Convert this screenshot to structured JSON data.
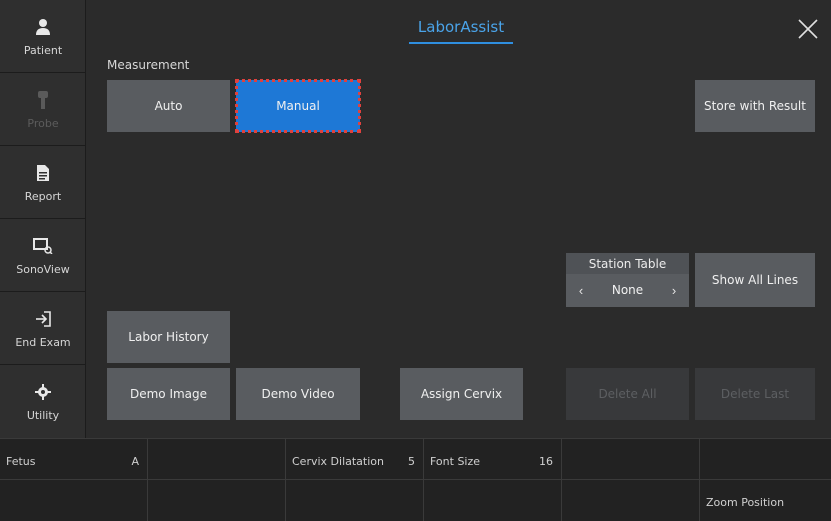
{
  "sidebar": {
    "items": [
      {
        "label": "Patient",
        "icon": "person-icon",
        "disabled": false
      },
      {
        "label": "Probe",
        "icon": "probe-icon",
        "disabled": true
      },
      {
        "label": "Report",
        "icon": "document-icon",
        "disabled": false
      },
      {
        "label": "SonoView",
        "icon": "image-search-icon",
        "disabled": false
      },
      {
        "label": "End Exam",
        "icon": "exit-icon",
        "disabled": false
      },
      {
        "label": "Utility",
        "icon": "gear-icon",
        "disabled": false
      }
    ]
  },
  "header": {
    "title": "LaborAssist"
  },
  "measurement": {
    "label": "Measurement",
    "auto_label": "Auto",
    "manual_label": "Manual",
    "selected": "Manual"
  },
  "buttons": {
    "store_with_result": "Store with Result",
    "show_all_lines": "Show All Lines",
    "labor_history": "Labor History",
    "demo_image": "Demo Image",
    "demo_video": "Demo Video",
    "assign_cervix": "Assign Cervix",
    "delete_all": "Delete All",
    "delete_last": "Delete Last"
  },
  "station_table": {
    "title": "Station Table",
    "value": "None",
    "prev": "‹",
    "next": "›"
  },
  "bottom_grid": {
    "row1": [
      {
        "key": "Fetus",
        "value": "A"
      },
      {
        "key": "",
        "value": ""
      },
      {
        "key": "Cervix Dilatation",
        "value": "5"
      },
      {
        "key": "Font Size",
        "value": "16"
      },
      {
        "key": "",
        "value": ""
      },
      {
        "key": "",
        "value": ""
      }
    ],
    "row2": [
      {
        "key": "",
        "value": ""
      },
      {
        "key": "",
        "value": ""
      },
      {
        "key": "",
        "value": ""
      },
      {
        "key": "",
        "value": ""
      },
      {
        "key": "",
        "value": ""
      },
      {
        "key": "Zoom Position",
        "value": ""
      }
    ]
  },
  "colors": {
    "accent": "#2f8fe0",
    "selected_button": "#1e78d6",
    "selection_outline": "#e0413d",
    "button": "#595c60",
    "background": "#2b2b2b"
  }
}
